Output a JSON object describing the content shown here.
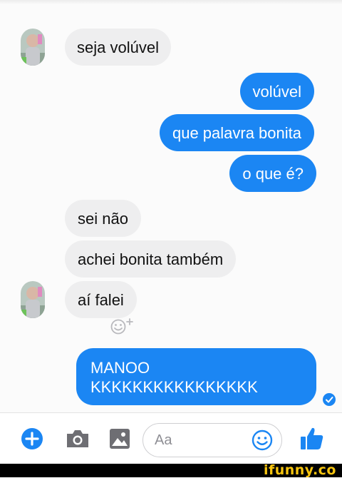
{
  "messages": [
    {
      "side": "in",
      "text": "seja volúvel"
    },
    {
      "side": "out",
      "text": "volúvel"
    },
    {
      "side": "out",
      "text": "que palavra bonita"
    },
    {
      "side": "out",
      "text": "o que é?"
    },
    {
      "side": "in",
      "text": "sei não"
    },
    {
      "side": "in",
      "text": "achei bonita também"
    },
    {
      "side": "in",
      "text": "aí falei"
    },
    {
      "side": "out",
      "lines": [
        "MANOO",
        "KKKKKKKKKKKKKKKK"
      ]
    }
  ],
  "composer": {
    "placeholder": "Aa",
    "icons": [
      "add-icon",
      "camera-icon",
      "gallery-icon",
      "emoji-icon",
      "like-icon"
    ]
  },
  "reaction_icon": "add-reaction-icon",
  "seen_icon": "check-icon",
  "watermark": "ifunny.co",
  "colors": {
    "outgoing_bubble": "#1b86f3",
    "incoming_bubble": "#eeeeef",
    "brand": "#f6c40f"
  }
}
